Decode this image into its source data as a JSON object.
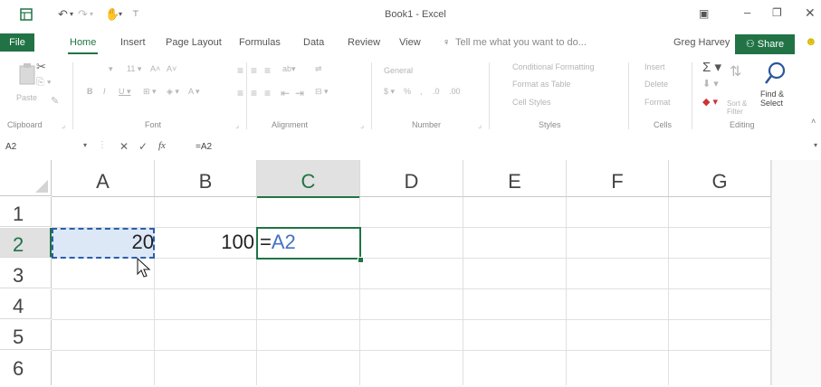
{
  "window": {
    "title": "Book1 - Excel",
    "user": "Greg Harvey"
  },
  "tabs": [
    "File",
    "Home",
    "Insert",
    "Page Layout",
    "Formulas",
    "Data",
    "Review",
    "View"
  ],
  "tell_me": "Tell me what you want to do...",
  "share_label": "Share",
  "ribbon": {
    "groups": [
      "Clipboard",
      "Font",
      "Alignment",
      "Number",
      "Styles",
      "Cells",
      "Editing"
    ],
    "paste_label": "Paste",
    "number_format": "General",
    "styles": [
      "Conditional Formatting",
      "Format as Table",
      "Cell Styles"
    ],
    "cells": [
      "Insert",
      "Delete",
      "Format"
    ],
    "sort_filter": "Sort & Filter",
    "find_select": "Find & Select"
  },
  "formula_bar": {
    "name_box": "A2",
    "formula": "=A2",
    "fx": "fx"
  },
  "columns": [
    "A",
    "B",
    "C",
    "D",
    "E",
    "F",
    "G"
  ],
  "rows": [
    "1",
    "2",
    "3",
    "4",
    "5",
    "6"
  ],
  "cells": {
    "A2": "20",
    "B2": "100",
    "C2_eq": "=",
    "C2_ref": "A2"
  },
  "colors": {
    "accent": "#217346",
    "ref_blue": "#4472c4"
  }
}
